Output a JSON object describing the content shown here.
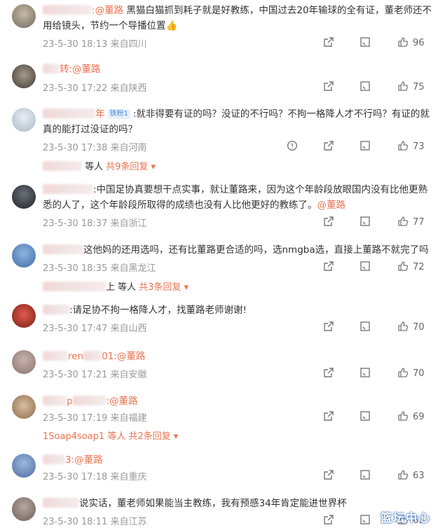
{
  "comments": [
    {
      "user_suffix": ":",
      "mention": "@董路",
      "text": "黑猫白猫抓到耗子就是好教练，中国过去20年输球的全有证，董老师还不用给镜头，节约一个导播位置👍",
      "date": "23-5-30 18:13",
      "source": "来自四川",
      "likes": "96"
    },
    {
      "user_suffix": "转",
      "mention": ":@董路",
      "text": "",
      "date": "23-5-30 17:22",
      "source": "来自陕西",
      "likes": "75"
    },
    {
      "user_suffix": "年",
      "badge": "铁粉1",
      "mention": "",
      "text": ":就非得要有证的吗？没证的不行吗？不拘一格降人才不行吗？有证的就真的能打过没证的吗？",
      "date": "23-5-30 17:38",
      "source": "来自河南",
      "likes": "73",
      "replies": {
        "who": "等人",
        "more": "共9条回复 ▾"
      }
    },
    {
      "user_suffix": "",
      "mention": "",
      "text": ":中国足协真要想干点实事，就让董路来，因为这个年龄段放眼国内没有比他更熟悉的人了，这个年龄段所取得的成绩也没有人比他更好的教练了。",
      "tail_mention": "@董路",
      "date": "23-5-30 18:37",
      "source": "来自浙江",
      "likes": "77"
    },
    {
      "user_suffix": "",
      "mention": "",
      "text": "这他妈的还用选吗，还有比董路更合适的吗，选nmgba选，直接上董路不就完了吗",
      "date": "23-5-30 18:35",
      "source": "来自黑龙江",
      "likes": "72",
      "replies": {
        "who": "上 等人",
        "more": "共3条回复 ▾"
      }
    },
    {
      "user_suffix": "",
      "mention": "",
      "text": ":请足协不拘一格降人才，找董路老师谢谢!",
      "date": "23-5-30 17:47",
      "source": "来自山西",
      "likes": "70"
    },
    {
      "user_suffix": "ren",
      "mention": "01:@董路",
      "text": "",
      "date": "23-5-30 17:21",
      "source": "来自安徽",
      "likes": "70"
    },
    {
      "user_suffix": "p",
      "mention": ":@董路",
      "text": "",
      "date": "23-5-30 17:19",
      "source": "来自福建",
      "likes": "69",
      "replies": {
        "who": "1Soap4soap1 等人",
        "more": "共2条回复 ▾"
      }
    },
    {
      "user_suffix": "3",
      "mention": ":@董路",
      "text": "",
      "date": "23-5-30 17:18",
      "source": "来自重庆",
      "likes": "63"
    },
    {
      "user_suffix": "",
      "mention": "",
      "text": "说实话，董老师如果能当主教练，我有预感34年肯定能进世界杯",
      "date": "23-5-30 18:11",
      "source": "来自江苏",
      "likes": "65"
    }
  ],
  "icons": {
    "share": "share-icon",
    "comment": "comment-icon",
    "like": "thumb-up-icon",
    "report": "report-icon"
  },
  "watermark": "篮坛中心"
}
